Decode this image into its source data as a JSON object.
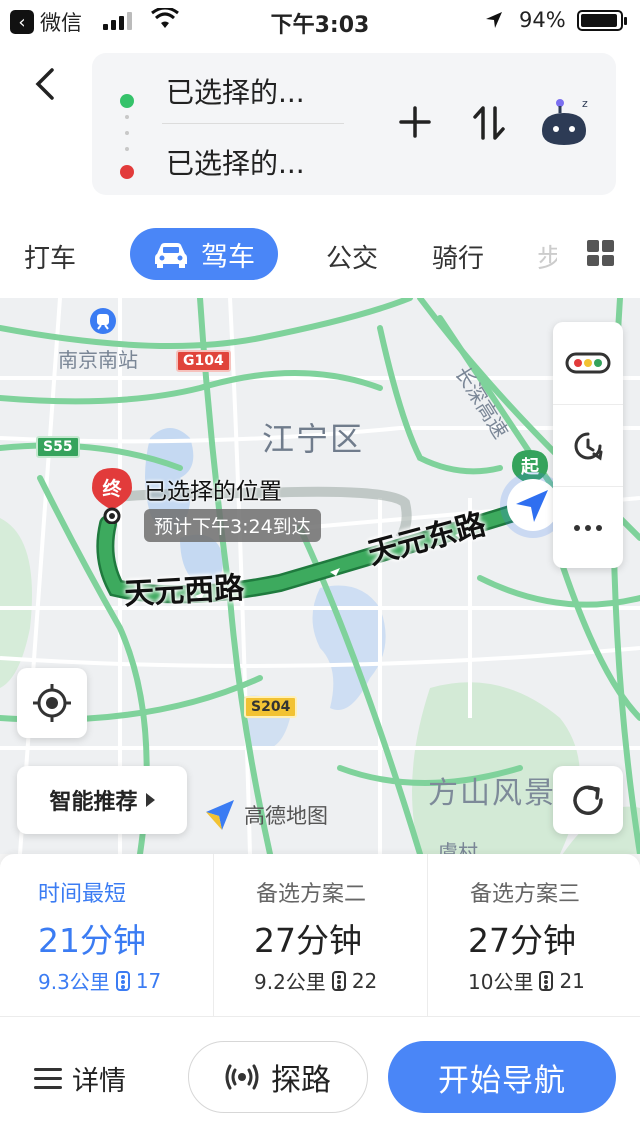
{
  "status_bar": {
    "back_app": "微信",
    "time": "下午3:03",
    "battery": "94%"
  },
  "route": {
    "from": "已选择的...",
    "to": "已选择的..."
  },
  "modes": {
    "taxi": "打车",
    "drive": "驾车",
    "transit": "公交",
    "bike": "骑行",
    "more_partial": "步"
  },
  "map": {
    "labels": {
      "station": "南京南站",
      "district": "江宁区",
      "scenic": "方山风景",
      "bottom_partial": "虞村",
      "changshen": "长深高速"
    },
    "roads": {
      "g104": "G104",
      "s55": "S55",
      "s204": "S204",
      "tianyuan_west": "天元西路",
      "tianyuan_east": "天元东路"
    },
    "pins": {
      "end": "终",
      "start": "起"
    },
    "destination_label": "已选择的位置",
    "eta": "预计下午3:24到达",
    "smart_recommend": "智能推荐",
    "logo_text": "高德地图"
  },
  "options": [
    {
      "label": "时间最短",
      "time": "21分钟",
      "distance": "9.3公里",
      "lights": "17"
    },
    {
      "label": "备选方案二",
      "time": "27分钟",
      "distance": "9.2公里",
      "lights": "22"
    },
    {
      "label": "备选方案三",
      "time": "27分钟",
      "distance": "10公里",
      "lights": "21"
    }
  ],
  "bottom": {
    "details": "详情",
    "explore": "探路",
    "start_nav": "开始导航"
  },
  "colors": {
    "accent": "#4a86f7",
    "route": "#3daa5e",
    "end_pin": "#e23b3b"
  }
}
